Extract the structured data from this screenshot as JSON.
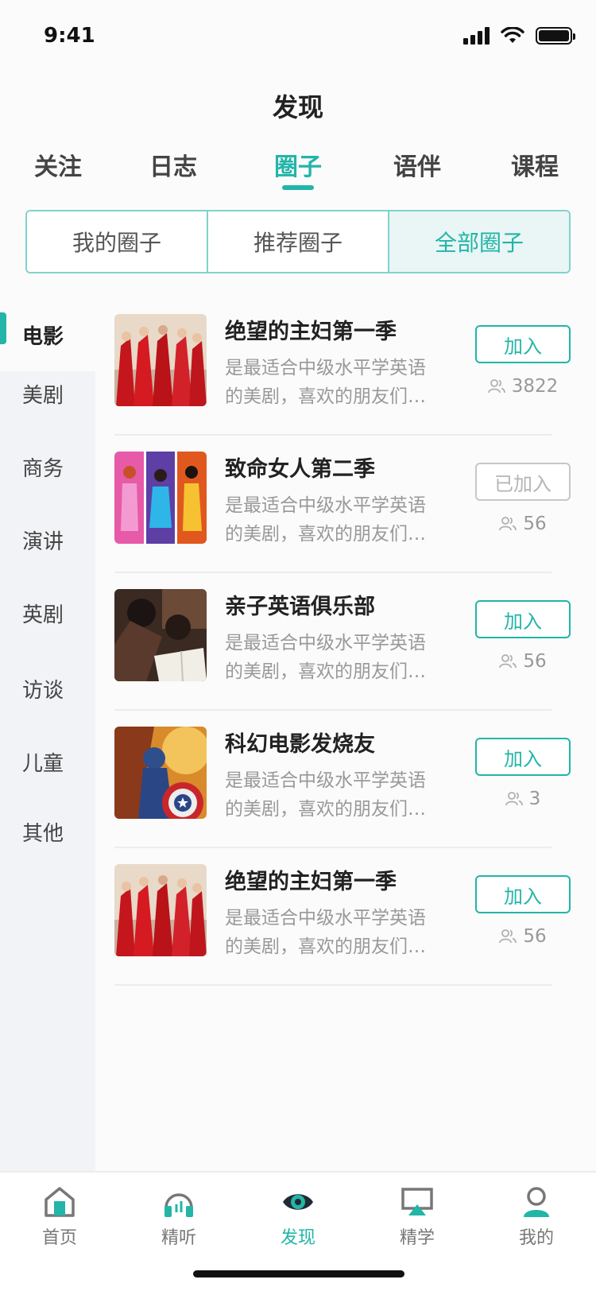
{
  "status_bar": {
    "time": "9:41"
  },
  "header": {
    "title": "发现"
  },
  "top_tabs": [
    {
      "label": "关注"
    },
    {
      "label": "日志"
    },
    {
      "label": "圈子",
      "active": true
    },
    {
      "label": "语伴"
    },
    {
      "label": "课程"
    }
  ],
  "segments": [
    {
      "label": "我的圈子"
    },
    {
      "label": "推荐圈子"
    },
    {
      "label": "全部圈子",
      "active": true
    }
  ],
  "sidebar": {
    "items": [
      {
        "label": "电影",
        "active": true
      },
      {
        "label": "美剧"
      },
      {
        "label": "商务"
      },
      {
        "label": "演讲"
      },
      {
        "label": "英剧"
      },
      {
        "label": "访谈"
      },
      {
        "label": "儿童"
      },
      {
        "label": "其他"
      }
    ]
  },
  "circles": [
    {
      "title": "绝望的主妇第一季",
      "desc_line1": "是最适合中级水平学英语",
      "desc_line2": "的美剧，喜欢的朋友们…",
      "button": "加入",
      "joined": false,
      "members": "3822"
    },
    {
      "title": "致命女人第二季",
      "desc_line1": "是最适合中级水平学英语",
      "desc_line2": "的美剧，喜欢的朋友们…",
      "button": "已加入",
      "joined": true,
      "members": "56"
    },
    {
      "title": "亲子英语俱乐部",
      "desc_line1": "是最适合中级水平学英语",
      "desc_line2": "的美剧，喜欢的朋友们…",
      "button": "加入",
      "joined": false,
      "members": "56"
    },
    {
      "title": "科幻电影发烧友",
      "desc_line1": "是最适合中级水平学英语",
      "desc_line2": "的美剧，喜欢的朋友们…",
      "button": "加入",
      "joined": false,
      "members": "3"
    },
    {
      "title": "绝望的主妇第一季",
      "desc_line1": "是最适合中级水平学英语",
      "desc_line2": "的美剧，喜欢的朋友们…",
      "button": "加入",
      "joined": false,
      "members": "56"
    }
  ],
  "bottom_nav": [
    {
      "label": "首页",
      "icon": "home-icon"
    },
    {
      "label": "精听",
      "icon": "headphones-icon"
    },
    {
      "label": "发现",
      "icon": "eye-icon",
      "active": true
    },
    {
      "label": "精学",
      "icon": "screen-icon"
    },
    {
      "label": "我的",
      "icon": "user-icon"
    }
  ],
  "colors": {
    "accent": "#22b5a8",
    "text": "#333333",
    "muted": "#999999"
  }
}
